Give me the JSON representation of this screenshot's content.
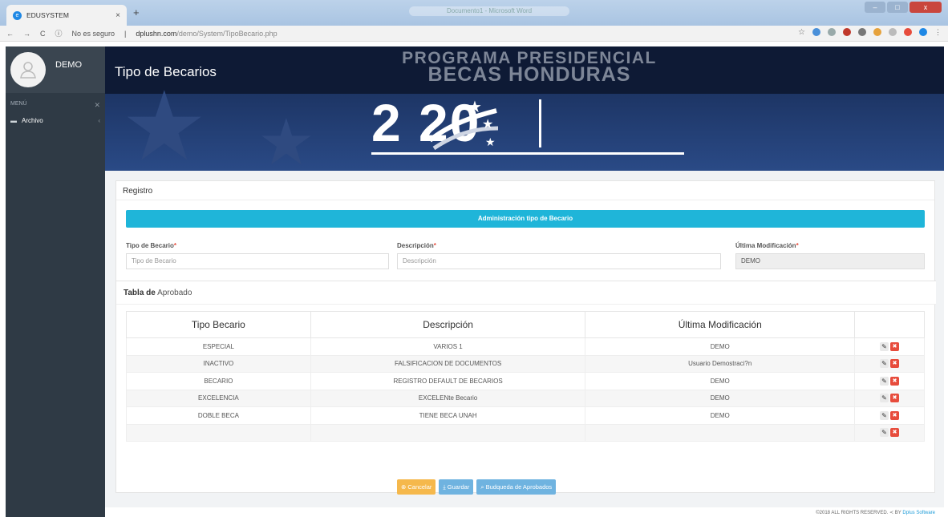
{
  "browser": {
    "tab_title": "EDUSYSTEM",
    "tab_close": "×",
    "new_tab": "+",
    "blurred_tab": "Documento1 - Microsoft Word",
    "security": "No es seguro",
    "url_host": "dplushn.com",
    "url_path": "/demo/System/TipoBecario.php",
    "nav_back": "←",
    "nav_forward": "→",
    "nav_reload": "C",
    "win_min": "–",
    "win_max": "□",
    "win_close": "x"
  },
  "sidebar": {
    "user_name": "DEMO",
    "menu_label": "MENÚ",
    "items": [
      {
        "label": "Archivo"
      }
    ]
  },
  "banner": {
    "page_title": "Tipo de Becarios",
    "program_line1": "PROGRAMA PRESIDENCIAL",
    "program_line2": "BECAS HONDURAS",
    "year": "2   20"
  },
  "registro": {
    "header": "Registro",
    "bar_title": "Administración tipo de Becario",
    "fields": [
      {
        "label": "Tipo de Becario",
        "placeholder": "Tipo de Becario"
      },
      {
        "label": "Descripción",
        "placeholder": "Descripción"
      },
      {
        "label": "Última Modificación",
        "value": "DEMO"
      }
    ],
    "required_mark": "*"
  },
  "tabla": {
    "header_bold": "Tabla de",
    "header_rest": "Aprobado",
    "columns": [
      "Tipo Becario",
      "Descripción",
      "Última Modificación",
      ""
    ],
    "rows": [
      [
        "ESPECIAL",
        "VARIOS 1",
        "DEMO"
      ],
      [
        "INACTIVO",
        "FALSIFICACION DE DOCUMENTOS",
        "Usuario Demostraci?n"
      ],
      [
        "BECARIO",
        "REGISTRO DEFAULT DE BECARIOS",
        "DEMO"
      ],
      [
        "EXCELENCIA",
        "EXCELENte Becario",
        "DEMO"
      ],
      [
        "DOBLE BECA",
        "TIENE BECA UNAH",
        "DEMO"
      ],
      [
        "",
        "",
        ""
      ]
    ]
  },
  "buttons": {
    "cancel": "Cancelar",
    "save": "Guardar",
    "search": "Budqueda de Aprobados"
  },
  "footer": {
    "text": "©2018 ALL RIGHTS RESERVED. ",
    "by": "BY ",
    "company": "Dplus Software"
  },
  "colors": {
    "sidebar": "#2f3a45",
    "accent_bar": "#1fb5d9",
    "cancel": "#f5b84c",
    "primary": "#6fb3e0",
    "delete": "#e74c3c"
  }
}
